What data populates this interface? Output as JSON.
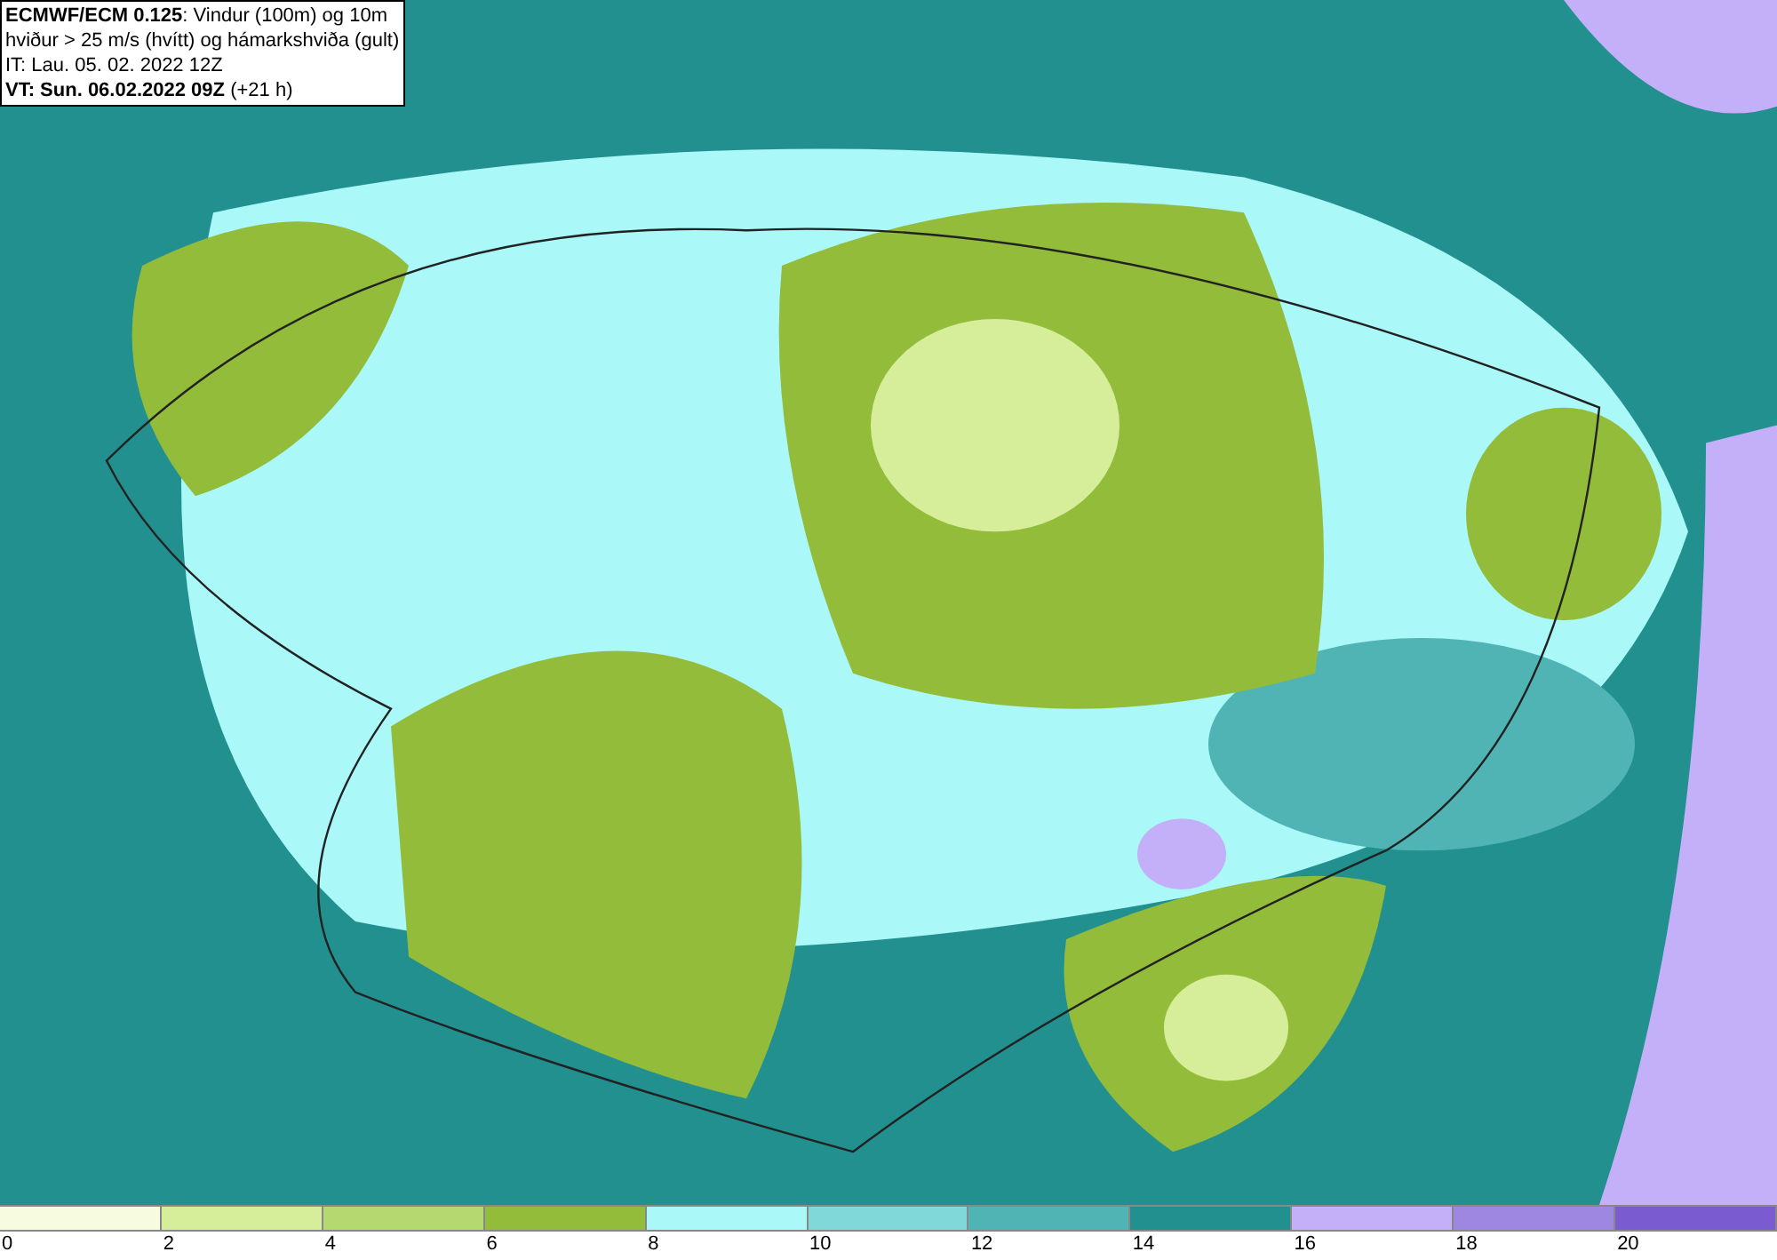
{
  "header": {
    "lines": [
      "**ECMWF/ECM 0.125**: Vindur (100m) og 10m",
      "hviður > 25 m/s (hvítt) og hámarkshviða (gult)",
      "IT: Lau. 05. 02. 2022 12Z",
      "**VT: Sun. 06.02.2022 09Z** (+21 h)"
    ]
  },
  "legend": [
    {
      "label": "0",
      "color": "#f7fce0"
    },
    {
      "label": "2",
      "color": "#d6ee9a"
    },
    {
      "label": "4",
      "color": "#b5d870"
    },
    {
      "label": "6",
      "color": "#93bc3a"
    },
    {
      "label": "8",
      "color": "#aaf8f8"
    },
    {
      "label": "10",
      "color": "#80d8d8"
    },
    {
      "label": "12",
      "color": "#50b4b4"
    },
    {
      "label": "14",
      "color": "#239090"
    },
    {
      "label": "16",
      "color": "#c3b0f8"
    },
    {
      "label": "18",
      "color": "#9d87e0"
    },
    {
      "label": "20",
      "color": "#7a5cd0"
    }
  ]
}
